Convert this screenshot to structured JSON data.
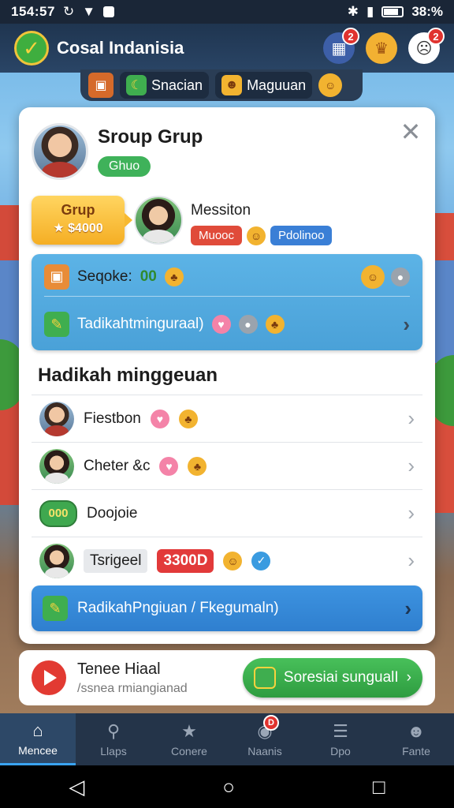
{
  "status_bar": {
    "time": "154:57",
    "battery": "38:%"
  },
  "header": {
    "title": "Cosal Indanisia",
    "notif_left": "2",
    "notif_right": "2"
  },
  "subtabs": [
    {
      "label": "Snacian"
    },
    {
      "label": "Maguuan"
    }
  ],
  "card": {
    "group_name": "Sroup Grup",
    "group_tag": "Ghuo",
    "grup_button": {
      "label": "Grup",
      "value": "$4000"
    },
    "member": {
      "name": "Messiton",
      "chip_red": "Muooc",
      "chip_blue": "Pdolinoo"
    },
    "panel": {
      "row1": {
        "label": "Seqoke:",
        "count": "00"
      },
      "row2": {
        "label": "Tadikahtminguraal)"
      }
    },
    "section_title": "Hadikah minggeuan",
    "list": [
      {
        "name": "Fiestbon"
      },
      {
        "name": "Cheter &c"
      },
      {
        "name": "Doojoie",
        "badge": "000"
      },
      {
        "name": "Tsrigeel",
        "tag": "3300D"
      }
    ],
    "cta": {
      "label": "RadikahPngiuan / Fkegumaln)"
    }
  },
  "banner": {
    "title": "Tenee Hiaal",
    "subtitle": "/ssnea rmiangianad",
    "button": "Soresiai sungualI"
  },
  "bottom_nav": [
    {
      "label": "Mencee",
      "icon": "home-icon"
    },
    {
      "label": "Llaps",
      "icon": "search-icon"
    },
    {
      "label": "Conere",
      "icon": "star-icon"
    },
    {
      "label": "Naanis",
      "icon": "chat-icon",
      "badge": "D"
    },
    {
      "label": "Dpo",
      "icon": "list-icon"
    },
    {
      "label": "Fante",
      "icon": "profile-icon"
    }
  ],
  "colors": {
    "accent": "#3aa3f0",
    "header_bg": "#1f3550",
    "green": "#3fae4f",
    "gold": "#f5ae24"
  }
}
